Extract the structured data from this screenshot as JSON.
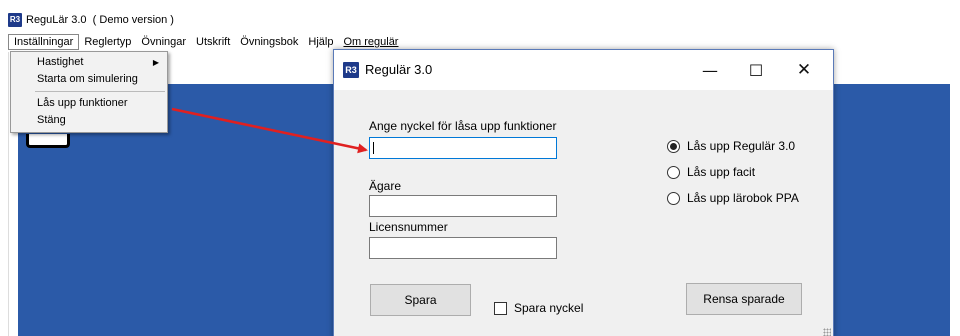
{
  "app": {
    "logo_text": "R3",
    "title": "ReguLär 3.0",
    "subtitle": "( Demo version )"
  },
  "menubar": {
    "items": [
      "Inställningar",
      "Reglertyp",
      "Övningar",
      "Utskrift",
      "Övningsbok",
      "Hjälp",
      "Om regulär"
    ]
  },
  "dropdown": {
    "items": [
      "Hastighet",
      "Starta om simulering",
      "Lås upp funktioner",
      "Stäng"
    ]
  },
  "dialog": {
    "logo_text": "R3",
    "title": "Regulär 3.0",
    "minimize_glyph": "—",
    "maximize_glyph": "☐",
    "close_glyph": "✕",
    "key_label": "Ange nyckel för låsa upp funktioner",
    "key_value": "",
    "owner_label": "Ägare",
    "owner_value": "",
    "license_label": "Licensnummer",
    "license_value": "",
    "radios": [
      {
        "label": "Lås upp Regulär 3.0",
        "checked": true
      },
      {
        "label": "Lås upp facit",
        "checked": false
      },
      {
        "label": "Lås upp lärobok PPA",
        "checked": false
      }
    ],
    "save_button": "Spara",
    "save_key_checkbox": "Spara nyckel",
    "save_key_checked": false,
    "clear_button": "Rensa sparade"
  },
  "colors": {
    "workspace_blue": "#2b5aa8",
    "annotation_arrow": "#e02020",
    "logo_blue": "#1e3a8a"
  }
}
